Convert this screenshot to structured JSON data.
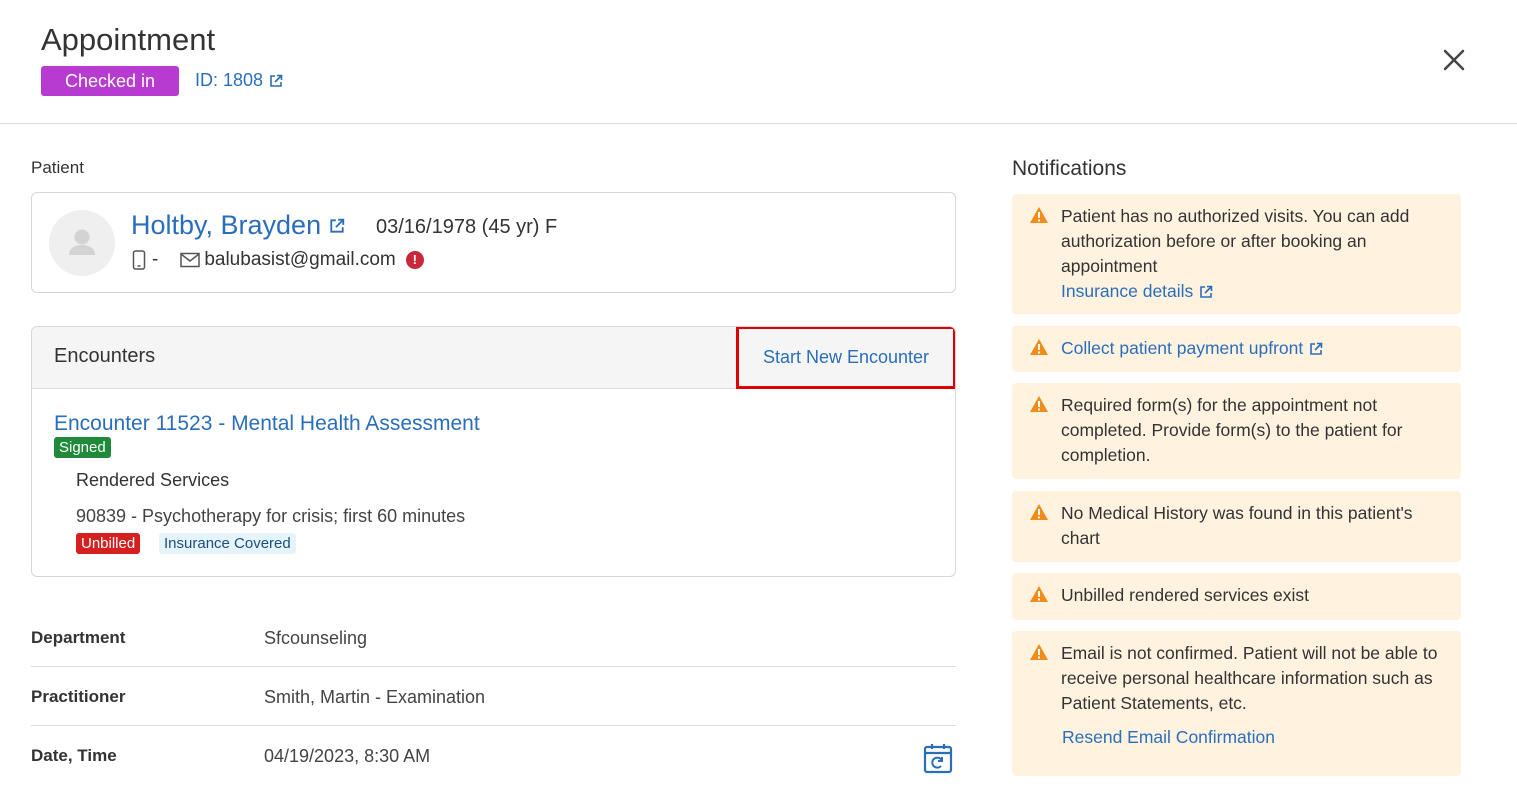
{
  "header": {
    "title": "Appointment",
    "status": "Checked in",
    "appointment_id": "ID: 1808"
  },
  "patient": {
    "section_label": "Patient",
    "name": "Holtby, Brayden",
    "dob_age_sex": "03/16/1978 (45 yr) F",
    "phone": "-",
    "email": "balubasist@gmail.com",
    "email_warning": "!"
  },
  "encounters": {
    "title": "Encounters",
    "new_button": "Start New Encounter",
    "items": [
      {
        "link": "Encounter 11523 - Mental Health Assessment",
        "status": "Signed",
        "rendered_label": "Rendered Services",
        "service": "90839 - Psychotherapy for crisis; first 60 minutes",
        "billing_badge": "Unbilled",
        "coverage_badge": "Insurance Covered"
      }
    ]
  },
  "details": [
    {
      "label": "Department",
      "value": "Sfcounseling"
    },
    {
      "label": "Practitioner",
      "value": "Smith, Martin - Examination"
    },
    {
      "label": "Date, Time",
      "value": "04/19/2023, 8:30 AM"
    }
  ],
  "notifications": {
    "title": "Notifications",
    "items": [
      {
        "text": "Patient has no authorized visits. You can add authorization before or after booking an appointment",
        "link": "Insurance details"
      },
      {
        "link": "Collect patient payment upfront"
      },
      {
        "text": "Required form(s) for the appointment not completed. Provide form(s) to the patient for completion."
      },
      {
        "text": "No Medical History was found in this patient's chart"
      },
      {
        "text": "Unbilled rendered services exist"
      },
      {
        "text": "Email is not confirmed. Patient will not be able to receive personal healthcare information such as Patient Statements, etc.",
        "link": "Resend Email Confirmation"
      }
    ]
  },
  "colors": {
    "accent_link": "#2a6ebb",
    "status_checked_in": "#b83bd1",
    "signed": "#1e8a3a",
    "unbilled": "#d61f1f",
    "notification_bg": "#fff3e0",
    "warning_icon": "#f08c1a",
    "highlight_box": "#e00000"
  },
  "icons": {
    "close": "close-icon",
    "external_link": "external-link-icon",
    "phone": "phone-icon",
    "email": "mail-icon",
    "warning": "warning-triangle-icon",
    "calendar_refresh": "calendar-refresh-icon",
    "avatar": "user-avatar-icon"
  }
}
